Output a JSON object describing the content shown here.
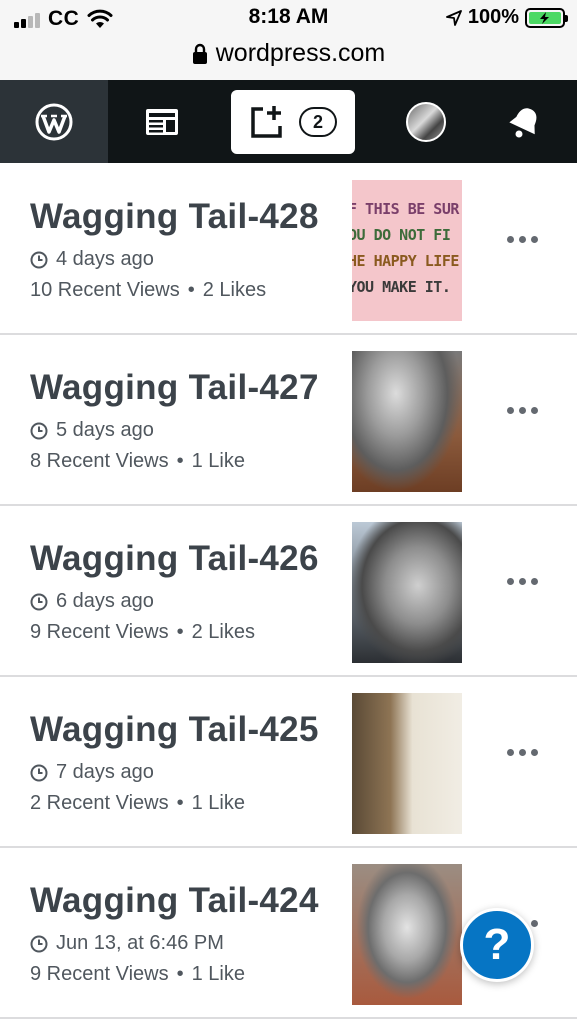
{
  "status_bar": {
    "carrier": "CC",
    "time": "8:18 AM",
    "battery_percent": "100%"
  },
  "browser": {
    "url": "wordpress.com"
  },
  "masterbar": {
    "write_count": "2",
    "items": [
      "wordpress-logo",
      "reader",
      "write",
      "me",
      "notifications"
    ]
  },
  "posts": [
    {
      "title": "Wagging Tail-428",
      "date": "4 days ago",
      "views": "10 Recent Views",
      "likes": "2 Likes",
      "thumbnail_text": [
        "F THIS BE SUR",
        "OU DO NOT FI",
        "HE HAPPY LIFE",
        "YOU MAKE IT."
      ]
    },
    {
      "title": "Wagging Tail-427",
      "date": "5 days ago",
      "views": "8 Recent Views",
      "likes": "1 Like"
    },
    {
      "title": "Wagging Tail-426",
      "date": "6 days ago",
      "views": "9 Recent Views",
      "likes": "2 Likes"
    },
    {
      "title": "Wagging Tail-425",
      "date": "7 days ago",
      "views": "2 Recent Views",
      "likes": "1 Like"
    },
    {
      "title": "Wagging Tail-424",
      "date": "Jun 13, at 6:46 PM",
      "views": "9 Recent Views",
      "likes": "1 Like"
    }
  ],
  "separator": "•",
  "help": {
    "label": "?"
  },
  "colors": {
    "masterbar_bg": "#101517",
    "help_blue": "#0675c4",
    "battery_green": "#4cd964"
  }
}
